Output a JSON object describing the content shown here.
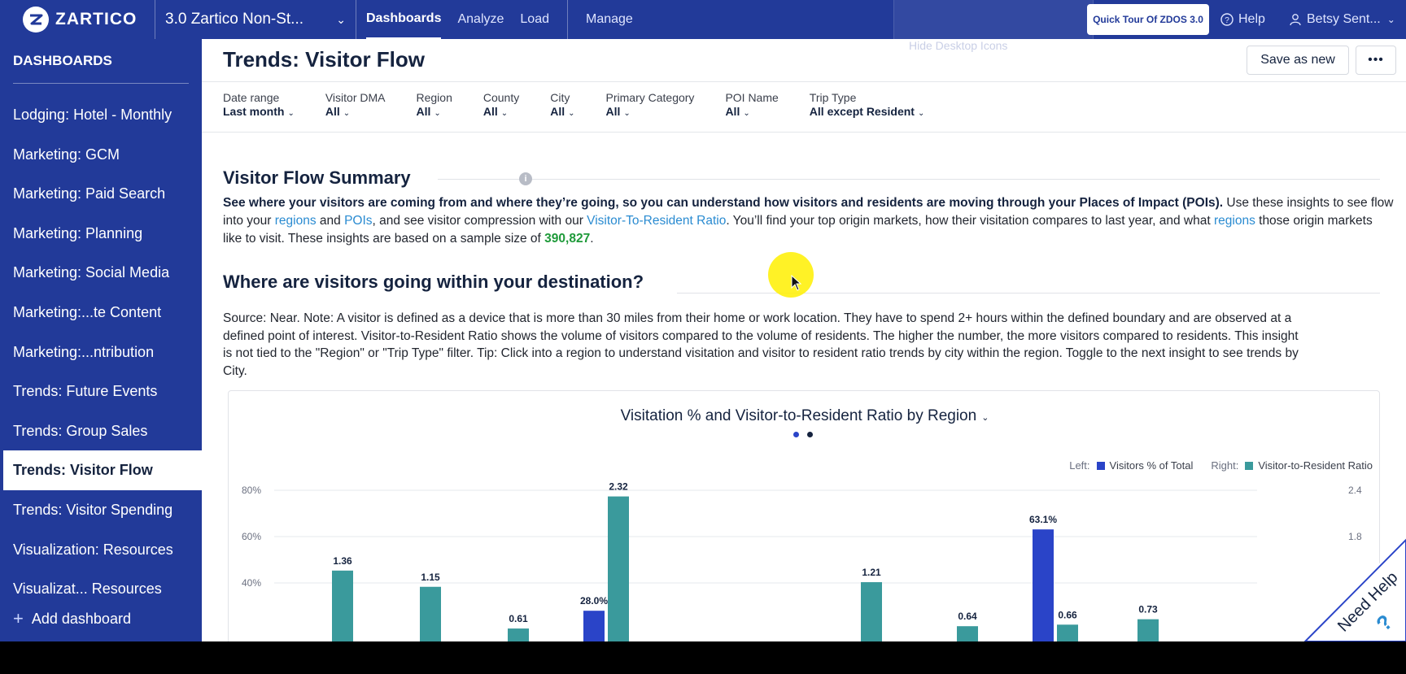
{
  "topbar": {
    "logo_text": "ZARTICO",
    "org_name": "3.0 Zartico Non-St...",
    "nav": [
      "Dashboards",
      "Analyze",
      "Load"
    ],
    "nav_manage": "Manage",
    "tour_label": "Quick Tour Of ZDOS 3.0",
    "help_label": "Help",
    "user_label": "Betsy Sent...",
    "ghost_menu_label": "Hide Desktop Icons"
  },
  "sidebar": {
    "title": "DASHBOARDS",
    "items": [
      "Lodging: Hotel - Monthly",
      "Marketing: GCM",
      "Marketing: Paid Search",
      "Marketing: Planning",
      "Marketing: Social Media",
      "Marketing:...te Content",
      "Marketing:...ntribution",
      "Trends: Future Events",
      "Trends: Group Sales",
      "Trends: Visitor Flow",
      "Trends: Visitor Spending",
      "Visualization: Resources",
      "Visualizat... Resources"
    ],
    "active_index": 9,
    "add_label": "Add dashboard"
  },
  "page": {
    "title": "Trends: Visitor Flow",
    "save_label": "Save as new",
    "more_label": "•••"
  },
  "filters": [
    {
      "label": "Date range",
      "value": "Last month"
    },
    {
      "label": "Visitor DMA",
      "value": "All"
    },
    {
      "label": "Region",
      "value": "All"
    },
    {
      "label": "County",
      "value": "All"
    },
    {
      "label": "City",
      "value": "All"
    },
    {
      "label": "Primary Category",
      "value": "All"
    },
    {
      "label": "POI Name",
      "value": "All"
    },
    {
      "label": "Trip Type",
      "value": "All except Resident"
    }
  ],
  "summary": {
    "title": "Visitor Flow Summary",
    "bold_text": "See where your visitors are coming from and where they’re going, so you can understand how visitors and residents are moving through your Places of Impact (POIs).",
    "t1": " Use these insights to see flow into your ",
    "link_regions": "regions",
    "t2": " and ",
    "link_pois": "POIs",
    "t3": ", and see visitor compression with our ",
    "link_ratio": "Visitor-To-Resident Ratio",
    "t4": ". You’ll find your top origin markets, how their visitation compares to last year, and what ",
    "link_regions2": "regions",
    "t5": " those origin markets like to visit. These insights are based on a sample size of ",
    "sample_size": "390,827",
    "t6": "."
  },
  "where": {
    "title": "Where are visitors going within your destination?",
    "note": "Source: Near. Note: A visitor is defined as a device that is more than 30 miles from their home or work location. They have to spend 2+ hours within the defined boundary and are observed at a defined point of interest. Visitor-to-Resident Ratio shows the volume of visitors compared to the volume of residents. The higher the number, the more visitors compared to residents. This insight is not tied to the \"Region\" or \"Trip Type\" filter. Tip: Click into a region to understand visitation and visitor to resident ratio trends by city within the region. Toggle to the next insight to see trends by City."
  },
  "chart_data": {
    "type": "bar",
    "title": "Visitation % and Visitor-to-Resident Ratio by Region",
    "legend": {
      "left_prefix": "Left:",
      "right_prefix": "Right:",
      "placement": "top-right"
    },
    "left_axis": {
      "ticks": [
        "80%",
        "60%",
        "40%"
      ],
      "ylim": [
        0,
        80
      ]
    },
    "right_axis": {
      "ticks": [
        "2.4",
        "1.8"
      ],
      "ylim": [
        0,
        2.4
      ]
    },
    "series": [
      {
        "name": "Visitors % of Total",
        "color": "#2a44c8",
        "axis": "left",
        "values": [
          null,
          null,
          null,
          28.0,
          null,
          null,
          null,
          63.1,
          null
        ],
        "labels": [
          "",
          "",
          "",
          "28.0%",
          "",
          "",
          "",
          "63.1%",
          ""
        ]
      },
      {
        "name": "Visitor-to-Resident Ratio",
        "color": "#3a9a9c",
        "axis": "right",
        "values": [
          1.36,
          1.15,
          0.61,
          2.32,
          null,
          1.21,
          0.64,
          0.66,
          0.73
        ],
        "labels": [
          "1.36",
          "1.15",
          "0.61",
          "2.32",
          "",
          "1.21",
          "0.64",
          "0.66",
          "0.73"
        ]
      }
    ],
    "grid": true
  },
  "colors": {
    "brand": "#223a99",
    "link": "#2a8bd1",
    "accent_green": "#1f9a3a"
  },
  "icons": {
    "logo": "zartico-logo-icon",
    "help": "question-circle-icon",
    "user": "user-icon",
    "info": "info-icon",
    "cursor": "mouse-cursor-icon"
  },
  "need_help": {
    "label": "Need Help",
    "icon": "?"
  }
}
